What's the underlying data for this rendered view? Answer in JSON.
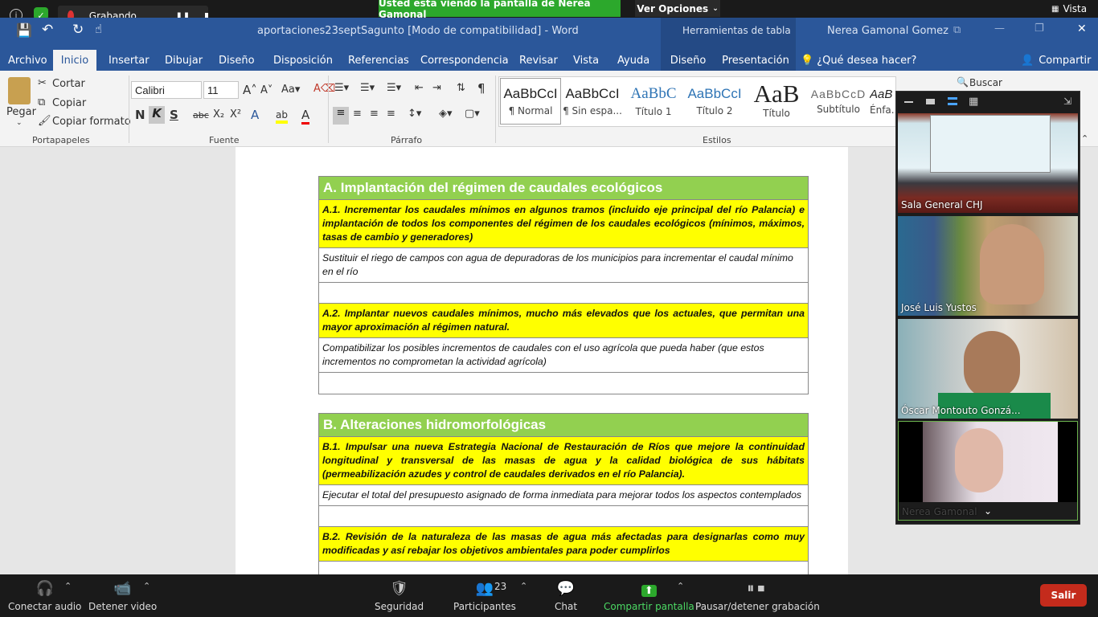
{
  "zoom_top": {
    "recording_label": "Grabando...",
    "banner": "Usted está viendo la pantalla de Nerea Gamonal",
    "view_options": "Ver Opciones",
    "view_label": "Vista"
  },
  "word": {
    "doc_title": "aportaciones23septSagunto [Modo de compatibilidad]  -  Word",
    "tools_title": "Herramientas de tabla",
    "user_name": "Nerea Gamonal Gomez",
    "tabs": [
      "Archivo",
      "Inicio",
      "Insertar",
      "Dibujar",
      "Diseño",
      "Disposición",
      "Referencias",
      "Correspondencia",
      "Revisar",
      "Vista",
      "Ayuda",
      "Diseño",
      "Presentación"
    ],
    "tell_me": "¿Qué desea hacer?",
    "share": "Compartir",
    "clipboard": {
      "paste": "Pegar",
      "cut": "Cortar",
      "copy": "Copiar",
      "format_painter": "Copiar formato",
      "group": "Portapapeles"
    },
    "font": {
      "name": "Calibri",
      "size": "11",
      "group": "Fuente"
    },
    "paragraph": {
      "group": "Párrafo"
    },
    "styles": {
      "group": "Estilos",
      "items": [
        {
          "sample": "AaBbCcI",
          "name": "¶ Normal"
        },
        {
          "sample": "AaBbCcI",
          "name": "¶ Sin espa..."
        },
        {
          "sample": "AaBbC",
          "name": "Título 1"
        },
        {
          "sample": "AaBbCcI",
          "name": "Título 2"
        },
        {
          "sample": "AaB",
          "name": "Título"
        },
        {
          "sample": "AaBbCcD",
          "name": "Subtítulo"
        },
        {
          "sample": "AaB",
          "name": "Énfa..."
        }
      ]
    },
    "search": "Buscar"
  },
  "document": {
    "section_a": {
      "title": "A. Implantación del régimen de caudales ecológicos",
      "a1": "A.1. Incrementar los caudales mínimos en algunos tramos (incluido eje principal del río Palancia) e implantación de todos los componentes del régimen de los caudales ecológicos (mínimos, máximos, tasas de cambio y generadores)",
      "a1_note": "Sustituir el riego de campos con agua de depuradoras de los municipios para incrementar el caudal mínimo en el río",
      "a2": "A.2. Implantar nuevos caudales mínimos, mucho más elevados que los actuales, que permitan una mayor aproximación al régimen natural.",
      "a2_note": "Compatibilizar los posibles incrementos de caudales con el uso agrícola que pueda haber (que estos incrementos no comprometan la actividad agrícola)"
    },
    "section_b": {
      "title": "B. Alteraciones hidromorfológicas",
      "b1": "B.1. Impulsar una nueva Estrategia Nacional de Restauración de Ríos que mejore la continuidad longitudinal y transversal de las masas de agua y la calidad biológica de sus hábitats (permeabilización azudes y control de caudales derivados en el río Palancia).",
      "b1_note": "Ejecutar el total del presupuesto asignado de forma inmediata para mejorar todos los aspectos contemplados",
      "b2": "B.2. Revisión de la naturaleza de las masas de agua más afectadas para designarlas como muy modificadas y así rebajar los objetivos ambientales para poder cumplirlos"
    }
  },
  "participants": [
    {
      "name": "Sala General CHJ"
    },
    {
      "name": "José Luis Yustos"
    },
    {
      "name": "Óscar Montouto Gonzá..."
    },
    {
      "name": "Nerea Gamonal"
    }
  ],
  "zoom_bottom": {
    "audio": "Conectar audio",
    "video": "Detener video",
    "security": "Seguridad",
    "participants": "Participantes",
    "participants_count": "23",
    "chat": "Chat",
    "share": "Compartir pantalla",
    "record": "Pausar/detener grabación",
    "leave": "Salir"
  },
  "colors": {
    "word_blue": "#2b579a",
    "header_green": "#92d050",
    "highlight_yellow": "#ffff00",
    "share_green": "#2ca82c",
    "leave_red": "#c42b1c"
  }
}
